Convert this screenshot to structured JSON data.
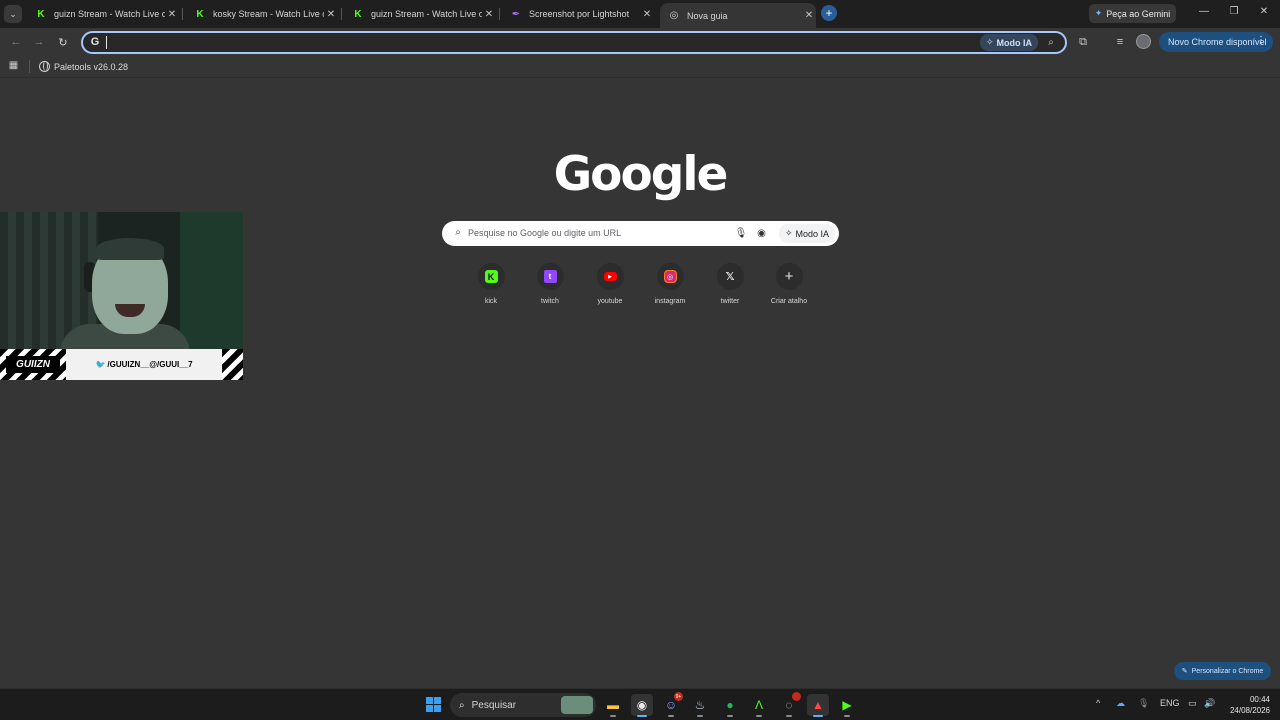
{
  "tabs": [
    {
      "title": "guizn Stream - Watch Live on Kick",
      "favicon": "kick-icon",
      "close": "✕"
    },
    {
      "title": "kosky Stream - Watch Live on Kick",
      "favicon": "kick-icon",
      "close": "✕"
    },
    {
      "title": "guizn Stream - Watch Live on Kick",
      "favicon": "kick-icon",
      "close": "✕"
    },
    {
      "title": "Screenshot por Lightshot",
      "favicon": "lightshot-icon",
      "close": "✕"
    },
    {
      "title": "Nova guia",
      "favicon": "chrome-icon",
      "close": "✕",
      "active": true
    }
  ],
  "tabstrip": {
    "new_tab": "+",
    "gemini_label": "Peça ao Gemini",
    "minimize": "—",
    "maximize": "❐",
    "close": "✕"
  },
  "toolbar": {
    "back": "←",
    "forward": "→",
    "reload": "↻",
    "omnibox_value": "",
    "modo_ia_label": "Modo IA",
    "update_label": "Novo Chrome disponível",
    "menu_dots": "⋮"
  },
  "bookmarks": [
    {
      "label": "Paletools v26.0.28",
      "icon": "globe-icon"
    }
  ],
  "main": {
    "logo": "Google",
    "search_placeholder": "Pesquise no Google ou digite um URL",
    "modo_ia_label": "Modo IA",
    "shortcuts": [
      {
        "label": "kick",
        "icon": "kick-icon"
      },
      {
        "label": "twitch",
        "icon": "twitch-icon"
      },
      {
        "label": "youtube",
        "icon": "youtube-icon"
      },
      {
        "label": "instagram",
        "icon": "instagram-icon"
      },
      {
        "label": "twitter",
        "icon": "x-icon"
      },
      {
        "label": "Criar atalho",
        "icon": "plus-icon"
      }
    ],
    "customize_label": "Personalizar o Chrome"
  },
  "webcam": {
    "logo_text": "GUIIZN",
    "social_text": "/GUUIZN__@/GUUI__7"
  },
  "taskbar": {
    "search_label": "Pesquisar",
    "discord_badge": "9+",
    "language": "ENG",
    "time": "00:44",
    "date": "24/08/2026"
  },
  "colors": {
    "page_bg": "#353535",
    "tabstrip_bg": "#1f1f1f",
    "accent": "#a8c7fa",
    "kick_green": "#53fc18",
    "update_pill": "#1d4f7f"
  }
}
